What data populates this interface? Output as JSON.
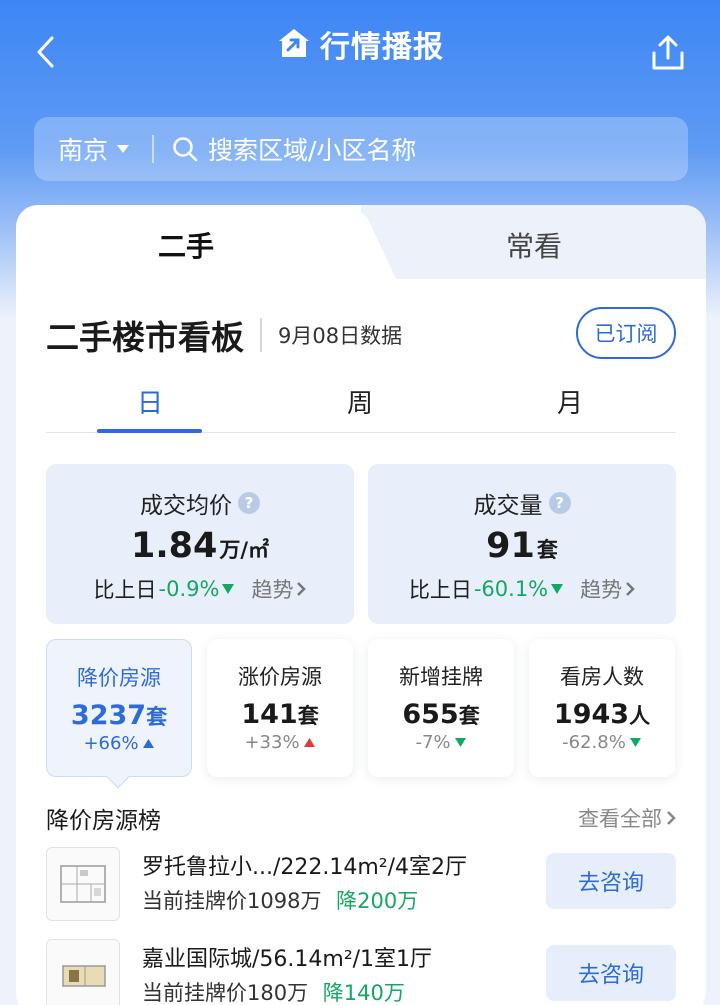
{
  "header": {
    "title": "行情播报",
    "colors": {
      "primary": "#3d86f5",
      "accent": "#2d6bd8",
      "down": "#13a862",
      "up": "#e53935"
    }
  },
  "search": {
    "city": "南京",
    "placeholder": "搜索区域/小区名称"
  },
  "tabs": {
    "second_hand": "二手",
    "frequent": "常看"
  },
  "board": {
    "title": "二手楼市看板",
    "date": "9月08日数据",
    "subscribe_label": "已订阅"
  },
  "periods": [
    "日",
    "周",
    "月"
  ],
  "stats": [
    {
      "title": "成交均价",
      "value": "1.84",
      "unit": "万/㎡",
      "compare_label": "比上日",
      "change": "-0.9%",
      "trend_label": "趋势"
    },
    {
      "title": "成交量",
      "value": "91",
      "unit": "套",
      "compare_label": "比上日",
      "change": "-60.1%",
      "trend_label": "趋势"
    }
  ],
  "metrics": [
    {
      "title": "降价房源",
      "value": "3237",
      "unit": "套",
      "change": "+66%",
      "direction": "up"
    },
    {
      "title": "涨价房源",
      "value": "141",
      "unit": "套",
      "change": "+33%",
      "direction": "up"
    },
    {
      "title": "新增挂牌",
      "value": "655",
      "unit": "套",
      "change": "-7%",
      "direction": "down"
    },
    {
      "title": "看房人数",
      "value": "1943",
      "unit": "人",
      "change": "-62.8%",
      "direction": "down"
    }
  ],
  "price_drop_list": {
    "title": "降价房源榜",
    "view_all": "查看全部",
    "items": [
      {
        "name": "罗托鲁拉小.../222.14m²/4室2厅",
        "price_label": "当前挂牌价1098万",
        "drop": "降200万",
        "action": "去咨询"
      },
      {
        "name": "嘉业国际城/56.14m²/1室1厅",
        "price_label": "当前挂牌价180万",
        "drop": "降140万",
        "action": "去咨询"
      }
    ]
  }
}
